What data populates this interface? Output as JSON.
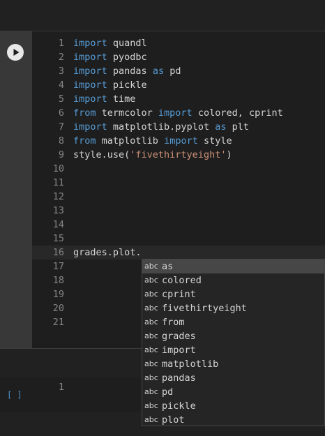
{
  "editor": {
    "lines": [
      {
        "num": "1",
        "tokens": [
          {
            "t": "import",
            "c": "kw"
          },
          {
            "t": " quandl",
            "c": "txt"
          }
        ]
      },
      {
        "num": "2",
        "tokens": [
          {
            "t": "import",
            "c": "kw"
          },
          {
            "t": " pyodbc",
            "c": "txt"
          }
        ]
      },
      {
        "num": "3",
        "tokens": [
          {
            "t": "import",
            "c": "kw"
          },
          {
            "t": " pandas ",
            "c": "txt"
          },
          {
            "t": "as",
            "c": "kw"
          },
          {
            "t": " pd",
            "c": "txt"
          }
        ]
      },
      {
        "num": "4",
        "tokens": [
          {
            "t": "import",
            "c": "kw"
          },
          {
            "t": " pickle",
            "c": "txt"
          }
        ]
      },
      {
        "num": "5",
        "tokens": [
          {
            "t": "import",
            "c": "kw"
          },
          {
            "t": " time",
            "c": "txt"
          }
        ]
      },
      {
        "num": "6",
        "tokens": [
          {
            "t": "from",
            "c": "kw"
          },
          {
            "t": " termcolor ",
            "c": "txt"
          },
          {
            "t": "import",
            "c": "kw"
          },
          {
            "t": " colored, cprint",
            "c": "txt"
          }
        ]
      },
      {
        "num": "7",
        "tokens": [
          {
            "t": "import",
            "c": "kw"
          },
          {
            "t": " matplotlib.pyplot ",
            "c": "txt"
          },
          {
            "t": "as",
            "c": "kw"
          },
          {
            "t": " plt",
            "c": "txt"
          }
        ]
      },
      {
        "num": "8",
        "tokens": [
          {
            "t": "from",
            "c": "kw"
          },
          {
            "t": " matplotlib ",
            "c": "txt"
          },
          {
            "t": "import",
            "c": "kw"
          },
          {
            "t": " style",
            "c": "txt"
          }
        ]
      },
      {
        "num": "9",
        "tokens": [
          {
            "t": "style.use(",
            "c": "txt"
          },
          {
            "t": "'fivethirtyeight'",
            "c": "str"
          },
          {
            "t": ")",
            "c": "txt"
          }
        ]
      },
      {
        "num": "10",
        "tokens": []
      },
      {
        "num": "11",
        "tokens": []
      },
      {
        "num": "12",
        "tokens": []
      },
      {
        "num": "13",
        "tokens": []
      },
      {
        "num": "14",
        "tokens": []
      },
      {
        "num": "15",
        "tokens": []
      },
      {
        "num": "16",
        "tokens": [
          {
            "t": "grades.plot.",
            "c": "txt"
          }
        ],
        "current": true
      },
      {
        "num": "17",
        "tokens": []
      },
      {
        "num": "18",
        "tokens": []
      },
      {
        "num": "19",
        "tokens": []
      },
      {
        "num": "20",
        "tokens": []
      },
      {
        "num": "21",
        "tokens": []
      }
    ]
  },
  "cell2": {
    "bracket": "[ ]",
    "line_number": "1"
  },
  "suggestions": {
    "icon_text": "abc",
    "items": [
      {
        "label": "as",
        "selected": true
      },
      {
        "label": "colored"
      },
      {
        "label": "cprint"
      },
      {
        "label": "fivethirtyeight"
      },
      {
        "label": "from"
      },
      {
        "label": "grades"
      },
      {
        "label": "import"
      },
      {
        "label": "matplotlib"
      },
      {
        "label": "pandas"
      },
      {
        "label": "pd"
      },
      {
        "label": "pickle"
      },
      {
        "label": "plot"
      }
    ]
  },
  "colors": {
    "keyword": "#569cd6",
    "string": "#ce9178",
    "text": "#d4d4d4",
    "line_number": "#858585",
    "background": "#1e1e1e"
  }
}
